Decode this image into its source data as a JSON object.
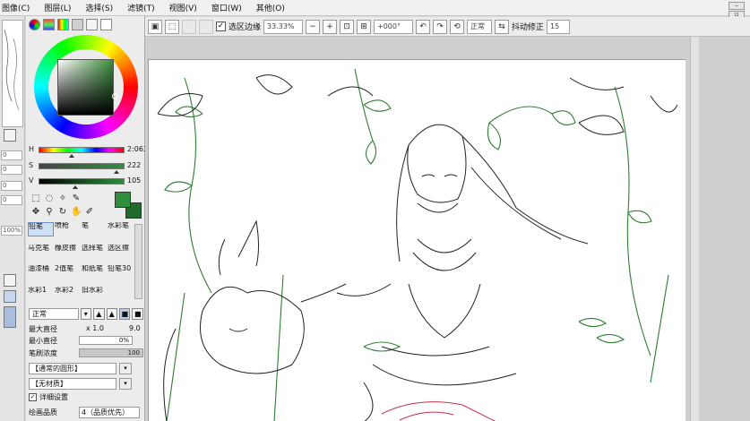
{
  "menu": {
    "items": [
      "图像(C)",
      "图层(L)",
      "选择(S)",
      "滤镜(T)",
      "视图(V)",
      "窗口(W)",
      "其他(O)"
    ]
  },
  "toolbar": {
    "selection_edge_label": "选区边缘",
    "zoom_value": "33.33%",
    "rotation_value": "+000°",
    "blend_mode": "正常",
    "stabilizer_label": "抖动修正",
    "stabilizer_value": "15"
  },
  "left_strip": {
    "field_values": [
      "0",
      "0",
      "0",
      "0",
      "100%"
    ]
  },
  "color_panel": {
    "sliders": [
      {
        "label": "H",
        "value": "2:063"
      },
      {
        "label": "S",
        "value": "222"
      },
      {
        "label": "V",
        "value": "105"
      }
    ],
    "fg_color": "#2f8f3e",
    "bg_color": "#1e6b2d"
  },
  "tools": {
    "row1": [
      "select-rect-icon",
      "lasso-icon",
      "magic-wand-icon",
      "brush-small-icon"
    ],
    "row2": [
      "move-icon",
      "zoom-icon",
      "rotate-icon",
      "hand-icon",
      "eyedropper-icon"
    ]
  },
  "brushes": [
    {
      "label": "铅笔",
      "selected": true
    },
    {
      "label": "喷枪",
      "selected": false
    },
    {
      "label": "笔",
      "selected": false
    },
    {
      "label": "水彩笔",
      "selected": false
    },
    {
      "label": "马克笔",
      "selected": false
    },
    {
      "label": "橡皮擦",
      "selected": false
    },
    {
      "label": "选择笔",
      "selected": false
    },
    {
      "label": "选区擦",
      "selected": false
    },
    {
      "label": "油漆桶",
      "selected": false
    },
    {
      "label": "2值笔",
      "selected": false
    },
    {
      "label": "和纸笔",
      "selected": false
    },
    {
      "label": "铅笔30",
      "selected": false
    },
    {
      "label": "水彩1",
      "selected": false
    },
    {
      "label": "水彩2",
      "selected": false
    },
    {
      "label": "旧水彩",
      "selected": false
    }
  ],
  "brush_settings": {
    "blend_mode": "正常",
    "max_size_label": "最大直径",
    "max_size_multiplier": "x 1.0",
    "max_size_value": "9.0",
    "min_size_label": "最小直径",
    "min_size_value": "0%",
    "density_label": "笔刷浓度",
    "density_value": "100",
    "density_fraction": 1.0,
    "shape_combo": "【通常的圆形】",
    "texture_combo": "【无材质】",
    "detail_label": "详细设置",
    "quality_label": "绘画品质",
    "quality_value": "4（品质优先）"
  }
}
